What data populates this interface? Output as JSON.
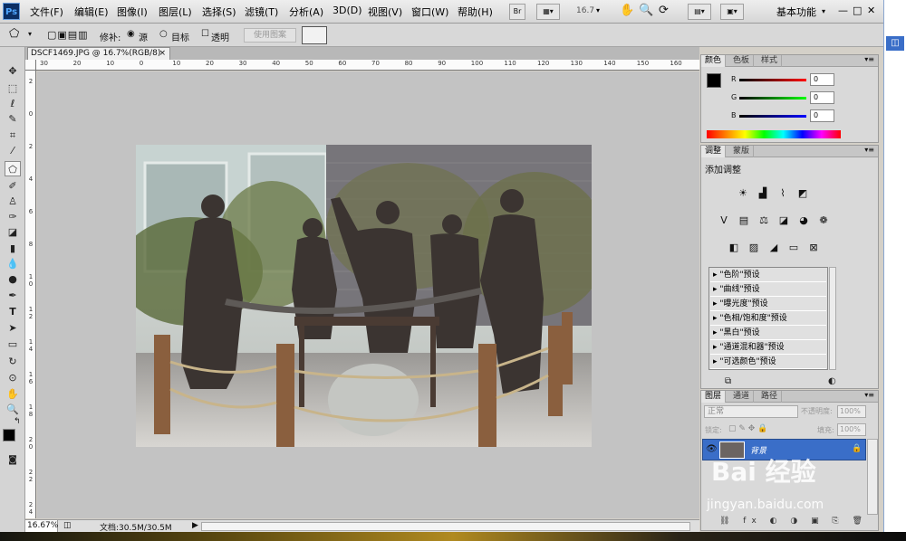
{
  "menubar": {
    "app_logo": "Ps",
    "items": [
      "文件(F)",
      "编辑(E)",
      "图像(I)",
      "图层(L)",
      "选择(S)",
      "滤镜(T)",
      "分析(A)",
      "3D(D)",
      "视图(V)",
      "窗口(W)",
      "帮助(H)"
    ],
    "zoom_value": "16.7",
    "workspace": "基本功能",
    "window_controls": [
      "—",
      "□",
      "✕"
    ]
  },
  "options_bar": {
    "repair_label": "修补:",
    "source_label": "源",
    "target_label": "目标",
    "transparent_label": "透明",
    "use_pattern_button": "使用图案"
  },
  "document": {
    "tab_title": "DSCF1469.JPG @ 16.7%(RGB/8)",
    "tab_close": "×",
    "ruler_h": [
      "30",
      "20",
      "10",
      "0",
      "10",
      "20",
      "30",
      "40",
      "50",
      "60",
      "70",
      "80",
      "90",
      "100",
      "110",
      "120",
      "130",
      "140",
      "150",
      "160"
    ],
    "ruler_v": [
      "2",
      "0",
      "2",
      "4",
      "6",
      "8",
      "1 0",
      "1 2",
      "1 4",
      "1 6",
      "1 8",
      "2 0",
      "2 2",
      "2 4"
    ],
    "status_zoom": "16.67%",
    "status_doc": "文档:30.5M/30.5M"
  },
  "color_panel": {
    "tabs": [
      "颜色",
      "色板",
      "样式"
    ],
    "r_label": "R",
    "g_label": "G",
    "b_label": "B",
    "r_value": "0",
    "g_value": "0",
    "b_value": "0",
    "foreground": "#000000",
    "background": "#ffffff"
  },
  "adjust_panel": {
    "tabs": [
      "调整",
      "蒙版"
    ],
    "title": "添加调整",
    "presets": [
      "\"色阶\"预设",
      "\"曲线\"预设",
      "\"曝光度\"预设",
      "\"色相/饱和度\"预设",
      "\"黑白\"预设",
      "\"通道混和器\"预设",
      "\"可选颜色\"预设"
    ]
  },
  "layers_panel": {
    "tabs": [
      "图层",
      "通道",
      "路径"
    ],
    "blend_mode": "正常",
    "opacity_label": "不透明度:",
    "opacity_value": "100%",
    "lock_label": "锁定:",
    "fill_label": "填充:",
    "fill_value": "100%",
    "layer_name": "背景"
  },
  "watermark": {
    "brand_text": "Bai 经验",
    "url_text": "jingyan.baidu.com"
  }
}
